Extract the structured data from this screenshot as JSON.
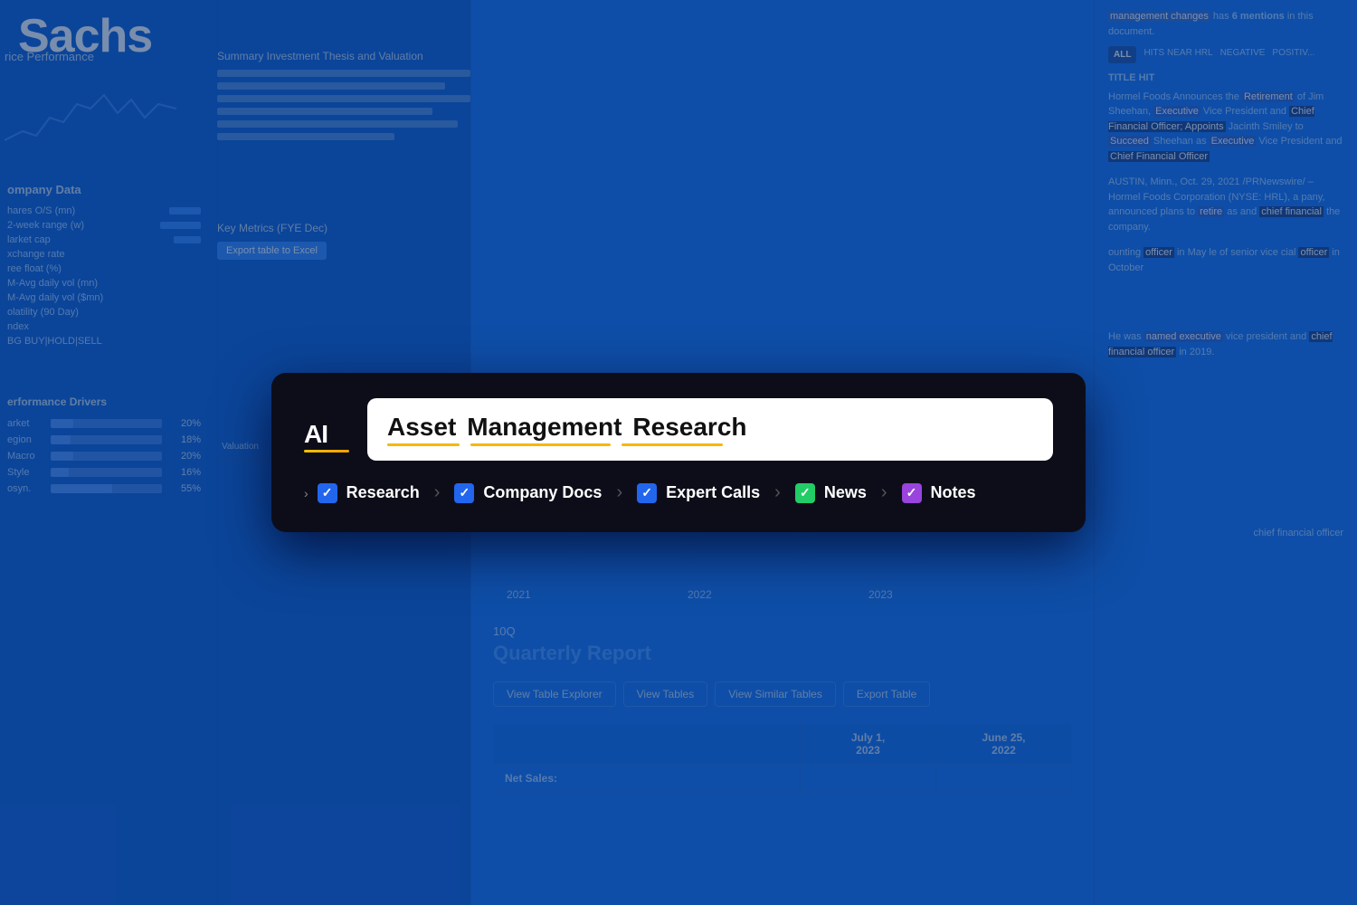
{
  "app": {
    "title": "Asset Management Research",
    "brand": "AI"
  },
  "background": {
    "company_name": "Sachs",
    "price_perf_label": "rice Performance",
    "company_data_label": "ompany Data",
    "company_data_rows": [
      {
        "label": "hares O/S (mn)",
        "has_bar": true
      },
      {
        "label": "2-week range (w)",
        "has_bar": true
      },
      {
        "label": "larket cap",
        "has_bar": true
      },
      {
        "label": "xchange rate",
        "has_bar": false
      },
      {
        "label": "ree float (%)",
        "has_bar": false
      },
      {
        "label": "M-Avg daily vol (mn)",
        "has_bar": false
      },
      {
        "label": "M-Avg daily vol ($mn)",
        "has_bar": false
      },
      {
        "label": "olatility (90 Day)",
        "has_bar": false
      },
      {
        "label": "ndex",
        "has_bar": false
      },
      {
        "label": "BG BUY|HOLD|SELL",
        "has_bar": false
      }
    ],
    "summary_title": "Summary Investment Thesis and Valuation",
    "key_metrics_title": "Key Metrics (FYE Dec)",
    "export_btn": "Export table to Excel",
    "perf_drivers_title": "erformance Drivers",
    "perf_rows": [
      {
        "label": "arket",
        "pct": "20%",
        "fill_pct": 20
      },
      {
        "label": "egion",
        "pct": "18%",
        "fill_pct": 18
      },
      {
        "label": "Macro",
        "pct": "20%",
        "fill_pct": 20
      },
      {
        "label": "Style",
        "pct": "16%",
        "fill_pct": 16
      },
      {
        "label": "osyn.",
        "pct": "55%",
        "fill_pct": 55
      }
    ]
  },
  "right_panel": {
    "mentions_text": "management changes",
    "mentions_count": "6 mentions",
    "filter_all": "ALL",
    "filter_hits": "HITS NEAR HRL",
    "filter_neg": "NEGATIVE",
    "filter_pos": "POSITIV...",
    "title_hit_label": "TITLE HIT",
    "article_text": "Hormel Foods Announces the Retirement of Jim Sheehan, Executive Vice President and Chief Financial Officer; Appoints Jacinth Smiley to Succeed Sheehan as Executive Vice President and Chief Financial Officer",
    "article_location": "AUSTIN, Minn., Oct. 29, 2021 /PRNewswire/ – Hormel Foods Corporation (NYSE: HRL), a company, announced plans to retire as and chief financial the company.",
    "article_text2": "ounting officer in May le of senior vice cial officer in October",
    "chief_financial_officer": "chief financial officer",
    "article_text3": "He was named executive vice president and chief financial officer in 2019."
  },
  "bottom_section": {
    "year_labels": [
      "2021",
      "2022",
      "2023"
    ],
    "report_type": "10Q",
    "quarterly_title": "Quarterly Report",
    "table_buttons": [
      {
        "label": "View Table Explorer",
        "active": false
      },
      {
        "label": "View Tables",
        "active": false
      },
      {
        "label": "View Similar Tables",
        "active": false
      },
      {
        "label": "Export Table",
        "active": false
      }
    ],
    "table_headers": [
      "Net Sales:",
      "July 1, 2023",
      "June 25, 2022"
    ]
  },
  "modal": {
    "logo_text": "AI",
    "search_text": "Asset Management Research",
    "search_segments": [
      "Asset",
      "Management",
      "Research"
    ],
    "nav_items": [
      {
        "label": "Research",
        "checkbox_color": "blue",
        "checked": true
      },
      {
        "label": "Company Docs",
        "checkbox_color": "blue",
        "checked": true
      },
      {
        "label": "Expert Calls",
        "checkbox_color": "blue",
        "checked": true
      },
      {
        "label": "News",
        "checkbox_color": "green",
        "checked": true
      },
      {
        "label": "Notes",
        "checkbox_color": "purple",
        "checked": true
      }
    ],
    "colors": {
      "modal_bg": "#0d0d1a",
      "search_bg": "#ffffff",
      "checkbox_blue": "#2266ee",
      "checkbox_green": "#22cc66",
      "checkbox_purple": "#9944dd"
    }
  }
}
